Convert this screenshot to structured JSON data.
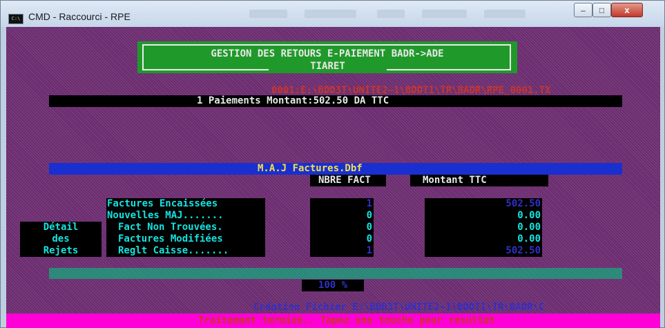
{
  "window": {
    "title": "CMD - Raccourci - RPE",
    "icon_label": "C:\\",
    "minimize_glyph": "–",
    "maximize_glyph": "□",
    "close_glyph": "x",
    "icon": "cmd-icon"
  },
  "header": {
    "title_line": "GESTION DES RETOURS E-PAIEMENT BADR->ADE",
    "subtitle": "TIARET"
  },
  "path_text": "0001:E:\\BDD3T\\UNITE2~1\\BDDT1\\TR\\BADR\\RPE_0001.TX",
  "summary": "1 Paiements Montant:502.50 DA TTC",
  "maj_label": "M.A.J Factures.Dbf",
  "columns": {
    "nbre": "NBRE FACT",
    "montant": "Montant TTC"
  },
  "rows": [
    {
      "label": "Factures Encaissées",
      "nbre": "1",
      "montant": "502.50"
    },
    {
      "label": "Nouvelles MAJ.......",
      "nbre": "0",
      "montant": "0.00"
    },
    {
      "label": "Fact Non Trouvées.",
      "nbre": "0",
      "montant": "0.00"
    },
    {
      "label": "Factures Modifiées",
      "nbre": "0",
      "montant": "0.00"
    },
    {
      "label": "Reglt Caisse.......",
      "nbre": "1",
      "montant": "502.50"
    }
  ],
  "detail_rejets": [
    "Détail",
    "des",
    "Rejets"
  ],
  "progress": {
    "percent_text": "100 %",
    "value": 1.0
  },
  "creation_text": "Création Fichier E:\\BDD3T\\UNITE2~1\\BDDT1\\TR\\BADR\\C",
  "status": "Traitement terminé.. Tapez une touche pour resultat",
  "colors": {
    "console_bg": "#6a2a6e",
    "header_green": "#1f9a2a",
    "cyan_text": "#14e3e0",
    "path_red": "#c5372d",
    "bar_blue": "#1a2fd0",
    "status_magenta": "#ff00d6",
    "status_text": "#c53a1c"
  }
}
